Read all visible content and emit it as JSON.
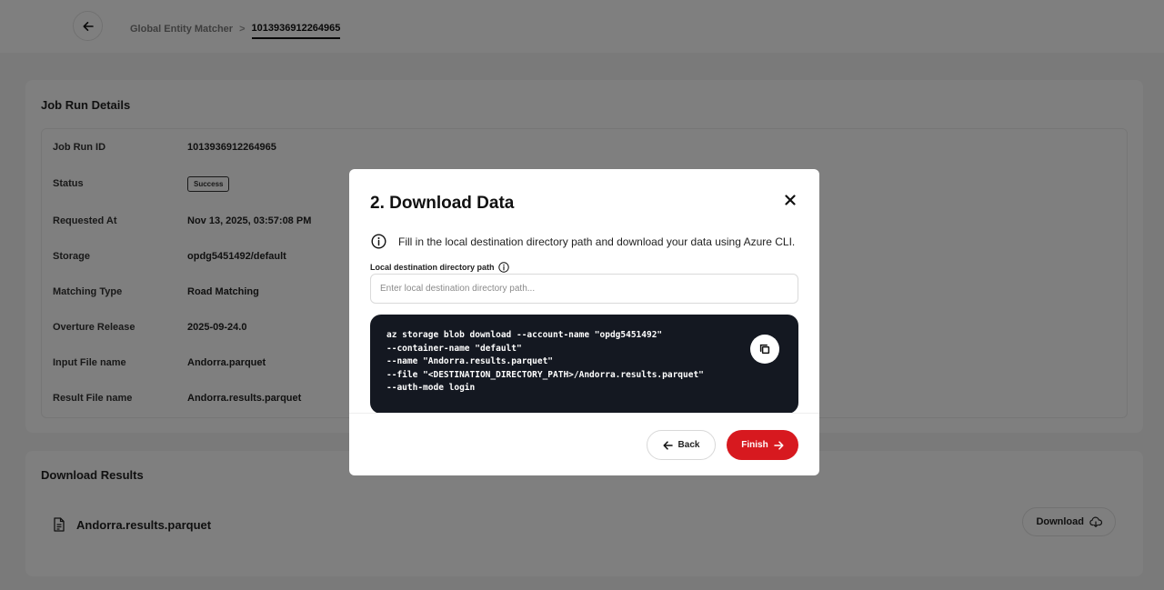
{
  "breadcrumb": {
    "parent": "Global Entity Matcher",
    "separator": ">",
    "current": "1013936912264965"
  },
  "job_details": {
    "title": "Job Run Details",
    "rows": [
      {
        "label": "Job Run ID",
        "value": "1013936912264965"
      },
      {
        "label": "Status",
        "value": "Success"
      },
      {
        "label": "Requested At",
        "value": "Nov 13, 2025, 03:57:08 PM"
      },
      {
        "label": "Storage",
        "value": "opdg5451492/default"
      },
      {
        "label": "Matching Type",
        "value": "Road Matching"
      },
      {
        "label": "Overture Release",
        "value": "2025-09-24.0"
      },
      {
        "label": "Input File name",
        "value": "Andorra.parquet"
      },
      {
        "label": "Result File name",
        "value": "Andorra.results.parquet"
      }
    ]
  },
  "download_results": {
    "title": "Download Results",
    "file_name": "Andorra.results.parquet",
    "download_label": "Download"
  },
  "modal": {
    "title": "2. Download Data",
    "info_text": "Fill in the local destination directory path and download your data using Azure CLI.",
    "field_label": "Local destination directory path",
    "field_value": "",
    "field_placeholder": "Enter local destination directory path...",
    "code_lines": [
      "az storage blob download --account-name \"opdg5451492\"",
      "--container-name \"default\"",
      "--name \"Andorra.results.parquet\"",
      "--file \"<DESTINATION_DIRECTORY_PATH>/Andorra.results.parquet\"",
      "--auth-mode login"
    ],
    "back_label": "Back",
    "finish_label": "Finish"
  },
  "colors": {
    "accent": "#d7191f",
    "code_background": "#141821",
    "overlay": "rgba(0,0,0,0.5)"
  },
  "icons": {
    "back": "arrow-left-icon",
    "close": "close-icon",
    "info": "info-icon",
    "copy": "copy-icon",
    "file": "file-icon",
    "cloud_download": "cloud-download-icon",
    "finish": "arrow-right-icon"
  }
}
